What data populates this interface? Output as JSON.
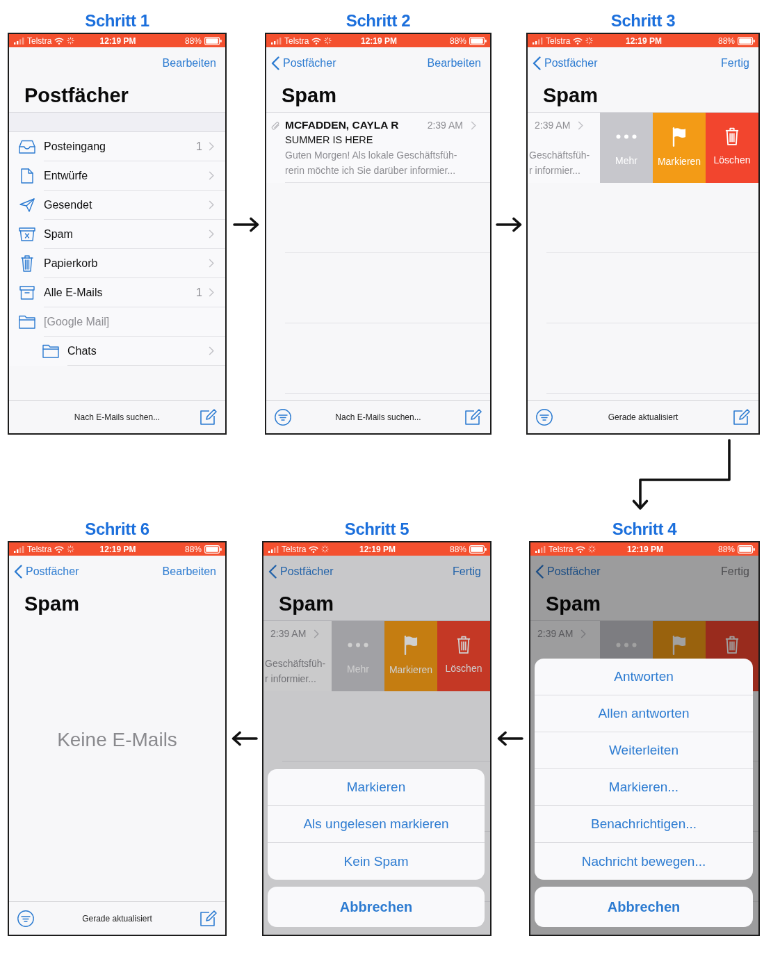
{
  "rows": [
    {
      "steps": [
        {
          "heading": "Schritt 1",
          "screen": {
            "status_bar": {
              "carrier": "Telstra",
              "time": "12:19 PM",
              "battery": "88%"
            },
            "nav": {
              "right": {
                "label": "Bearbeiten",
                "disabled": false
              }
            },
            "title": "Postfächer",
            "content": {
              "kind": "mailboxes",
              "items": [
                {
                  "kind": "inbox",
                  "label": "Posteingang",
                  "count": "1",
                  "disabled": false
                },
                {
                  "kind": "drafts",
                  "label": "Entwürfe",
                  "disabled": false
                },
                {
                  "kind": "sent",
                  "label": "Gesendet",
                  "disabled": false
                },
                {
                  "kind": "spam",
                  "label": "Spam",
                  "disabled": false
                },
                {
                  "kind": "trash",
                  "label": "Papierkorb",
                  "disabled": false
                },
                {
                  "kind": "archive",
                  "label": "Alle E-Mails",
                  "count": "1",
                  "disabled": false
                },
                {
                  "kind": "folder",
                  "label": "[Google Mail]",
                  "disabled": true,
                  "children": [
                    {
                      "kind": "folder",
                      "label": "Chats",
                      "disabled": false
                    }
                  ]
                }
              ]
            },
            "toolbar": {
              "filter": false,
              "status": "Nach E-Mails suchen..."
            }
          }
        },
        {
          "heading": "Schritt 2",
          "screen": {
            "status_bar": {
              "carrier": "Telstra",
              "time": "12:19 PM",
              "battery": "88%"
            },
            "nav": {
              "back": "Postfächer",
              "right": {
                "label": "Bearbeiten",
                "disabled": false
              }
            },
            "title": "Spam",
            "content": {
              "kind": "messages",
              "items": [
                {
                  "swiped": false,
                  "attachment": true,
                  "sender": "MCFADDEN, CAYLA R",
                  "time": "2:39 AM",
                  "subject": "SUMMER IS HERE",
                  "preview": [
                    "Guten Morgen! Als lokale Geschäftsfüh-",
                    "rerin möchte ich Sie darüber informier..."
                  ]
                }
              ]
            },
            "toolbar": {
              "filter": true,
              "status": "Nach E-Mails suchen..."
            }
          }
        },
        {
          "heading": "Schritt 3",
          "screen": {
            "status_bar": {
              "carrier": "Telstra",
              "time": "12:19 PM",
              "battery": "88%"
            },
            "nav": {
              "back": "Postfächer",
              "right": {
                "label": "Fertig",
                "disabled": false
              }
            },
            "title": "Spam",
            "content": {
              "kind": "messages",
              "items": [
                {
                  "swiped": true,
                  "time": "2:39 AM",
                  "preview": [
                    "Geschäftsfüh-",
                    "r informier..."
                  ],
                  "actions": [
                    {
                      "kind": "more",
                      "label": "Mehr"
                    },
                    {
                      "kind": "flag",
                      "label": "Markieren"
                    },
                    {
                      "kind": "delete",
                      "label": "Löschen"
                    }
                  ]
                }
              ]
            },
            "toolbar": {
              "filter": true,
              "status": "Gerade aktualisiert"
            }
          }
        }
      ]
    },
    {
      "steps": [
        {
          "heading": "Schritt 6",
          "screen": {
            "status_bar": {
              "carrier": "Telstra",
              "time": "12:19 PM",
              "battery": "88%"
            },
            "nav": {
              "back": "Postfächer",
              "right": {
                "label": "Bearbeiten",
                "disabled": false
              }
            },
            "title": "Spam",
            "content": {
              "kind": "empty",
              "message": "Keine E-Mails"
            },
            "toolbar": {
              "filter": true,
              "status": "Gerade aktualisiert"
            }
          }
        },
        {
          "heading": "Schritt 5",
          "screen": {
            "status_bar": {
              "carrier": "Telstra",
              "time": "12:19 PM",
              "battery": "88%"
            },
            "nav": {
              "back": "Postfächer",
              "right": {
                "label": "Fertig",
                "disabled": false
              }
            },
            "title": "Spam",
            "content": {
              "kind": "messages",
              "items": [
                {
                  "swiped": true,
                  "time": "2:39 AM",
                  "preview": [
                    "Geschäftsfüh-",
                    "r informier..."
                  ],
                  "actions": [
                    {
                      "kind": "more",
                      "label": "Mehr"
                    },
                    {
                      "kind": "flag",
                      "label": "Markieren"
                    },
                    {
                      "kind": "delete",
                      "label": "Löschen"
                    }
                  ]
                }
              ]
            },
            "sheet": {
              "dark": false,
              "options": [
                "Markieren",
                "Als ungelesen markieren",
                "Kein Spam"
              ],
              "cancel": "Abbrechen"
            }
          }
        },
        {
          "heading": "Schritt 4",
          "screen": {
            "status_bar": {
              "carrier": "Telstra",
              "time": "12:19 PM",
              "battery": "88%"
            },
            "nav": {
              "back": "Postfächer",
              "right": {
                "label": "Fertig",
                "disabled": true
              }
            },
            "title": "Spam",
            "content": {
              "kind": "messages",
              "items": [
                {
                  "swiped": true,
                  "time": "2:39 AM",
                  "actions": [
                    {
                      "kind": "more"
                    },
                    {
                      "kind": "flag"
                    },
                    {
                      "kind": "delete"
                    }
                  ]
                }
              ]
            },
            "sheet": {
              "dark": true,
              "options": [
                "Antworten",
                "Allen antworten",
                "Weiterleiten",
                "Markieren...",
                "Benachrichtigen...",
                "Nachricht bewegen..."
              ],
              "cancel": "Abbrechen"
            }
          }
        }
      ]
    }
  ]
}
